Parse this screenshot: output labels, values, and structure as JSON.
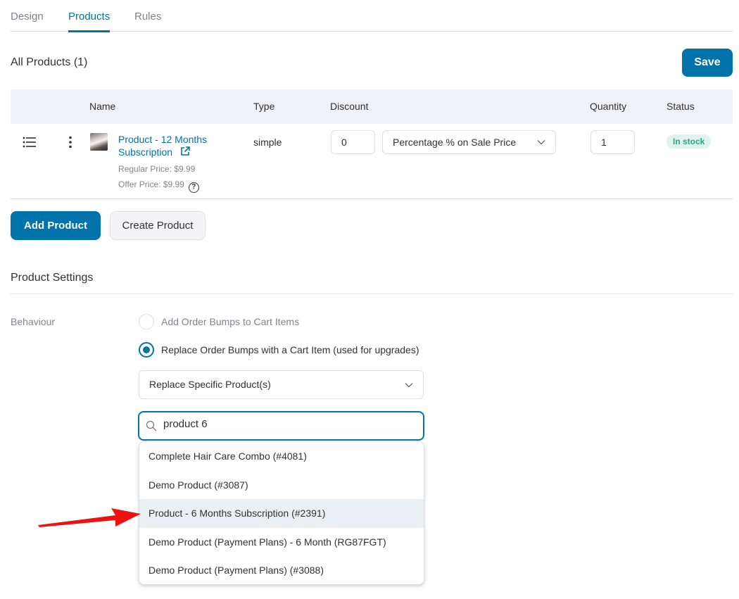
{
  "tabs": [
    {
      "label": "Design",
      "active": false
    },
    {
      "label": "Products",
      "active": true
    },
    {
      "label": "Rules",
      "active": false
    }
  ],
  "all_products": {
    "title": "All Products (1)",
    "save_label": "Save"
  },
  "table": {
    "headers": {
      "name": "Name",
      "type": "Type",
      "discount": "Discount",
      "quantity": "Quantity",
      "status": "Status"
    },
    "rows": [
      {
        "name": "Product - 12 Months Subscription",
        "regular_price": "Regular Price: $9.99",
        "offer_price": "Offer Price: $9.99",
        "type": "simple",
        "discount_value": "0",
        "discount_type": "Percentage % on Sale Price",
        "quantity": "1",
        "status": "In stock"
      }
    ]
  },
  "actions": {
    "add_product": "Add Product",
    "create_product": "Create Product"
  },
  "product_settings": {
    "title": "Product Settings",
    "behaviour_label": "Behaviour",
    "options": [
      {
        "label": "Add Order Bumps to Cart Items",
        "checked": false
      },
      {
        "label": "Replace Order Bumps with a Cart Item (used for upgrades)",
        "checked": true
      }
    ],
    "replace_mode": "Replace Specific Product(s)",
    "search_value": "product 6",
    "results": [
      {
        "label": "Complete Hair Care Combo (#4081)",
        "highlighted": false
      },
      {
        "label": "Demo Product (#3087)",
        "highlighted": false
      },
      {
        "label": "Product - 6 Months Subscription (#2391)",
        "highlighted": true
      },
      {
        "label": "Demo Product (Payment Plans) - 6 Month (RG87FGT)",
        "highlighted": false
      },
      {
        "label": "Demo Product (Payment Plans) (#3088)",
        "highlighted": false
      }
    ]
  },
  "colors": {
    "accent": "#0073aa",
    "status_in_stock_bg": "#ddf3ec",
    "status_in_stock_text": "#2aa681",
    "annotation_arrow": "#ee1111"
  }
}
